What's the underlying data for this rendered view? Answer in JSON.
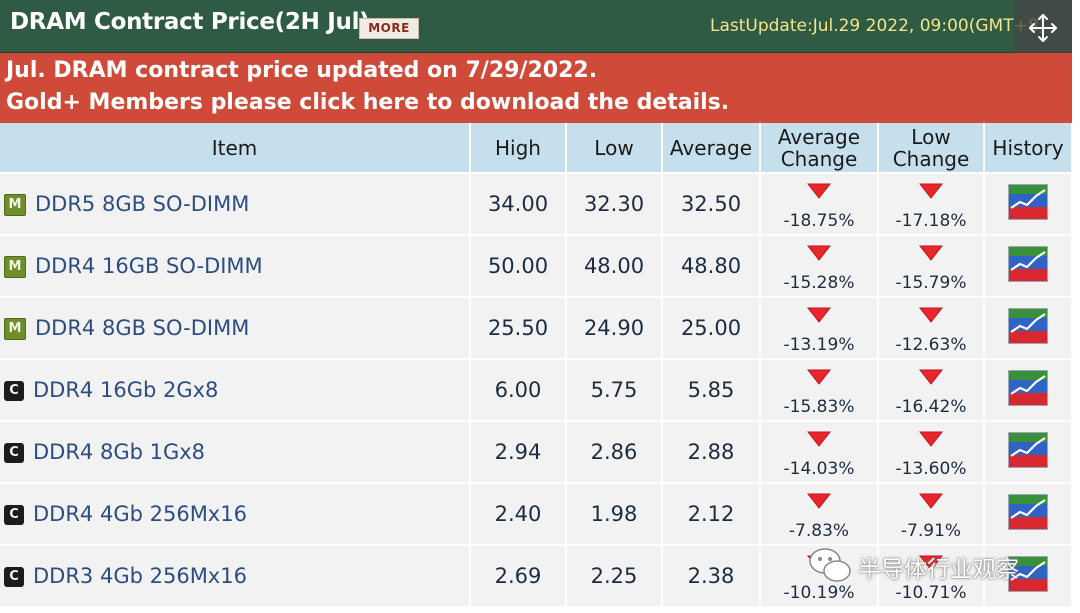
{
  "header": {
    "title": "DRAM Contract Price(2H Jul)",
    "more_label": "MORE",
    "last_update": "LastUpdate:Jul.29 2022, 09:00(GMT+8)"
  },
  "banner": {
    "line1": "Jul. DRAM contract price updated on 7/29/2022.",
    "line2": "Gold+ Members please click here to download the details."
  },
  "table": {
    "columns": {
      "item": "Item",
      "high": "High",
      "low": "Low",
      "average": "Average",
      "avg_change": "Average Change",
      "low_change": "Low Change",
      "history": "History"
    },
    "rows": [
      {
        "icon": "module-icon",
        "item": "DDR5 8GB SO-DIMM",
        "high": "34.00",
        "low": "32.30",
        "average": "32.50",
        "avg_change": "-18.75%",
        "low_change": "-17.18%"
      },
      {
        "icon": "module-icon",
        "item": "DDR4 16GB SO-DIMM",
        "high": "50.00",
        "low": "48.00",
        "average": "48.80",
        "avg_change": "-15.28%",
        "low_change": "-15.79%"
      },
      {
        "icon": "module-icon",
        "item": "DDR4 8GB SO-DIMM",
        "high": "25.50",
        "low": "24.90",
        "average": "25.00",
        "avg_change": "-13.19%",
        "low_change": "-12.63%"
      },
      {
        "icon": "chip-icon",
        "item": "DDR4 16Gb 2Gx8",
        "high": "6.00",
        "low": "5.75",
        "average": "5.85",
        "avg_change": "-15.83%",
        "low_change": "-16.42%"
      },
      {
        "icon": "chip-icon",
        "item": "DDR4 8Gb 1Gx8",
        "high": "2.94",
        "low": "2.86",
        "average": "2.88",
        "avg_change": "-14.03%",
        "low_change": "-13.60%"
      },
      {
        "icon": "chip-icon",
        "item": "DDR4 4Gb 256Mx16",
        "high": "2.40",
        "low": "1.98",
        "average": "2.12",
        "avg_change": "-7.83%",
        "low_change": "-7.91%"
      },
      {
        "icon": "chip-icon",
        "item": "DDR3 4Gb 256Mx16",
        "high": "2.69",
        "low": "2.25",
        "average": "2.38",
        "avg_change": "-10.19%",
        "low_change": "-10.71%"
      }
    ]
  },
  "watermark": {
    "text": "半导体行业观察"
  },
  "colors": {
    "header_bg": "#2f5a44",
    "banner_bg": "#d04a3a",
    "table_header_bg": "#c5dfec",
    "row_bg": "#f2f2f2",
    "down_arrow": "#e8262b",
    "item_link": "#2d4c7f",
    "update_text": "#f3e58a"
  }
}
